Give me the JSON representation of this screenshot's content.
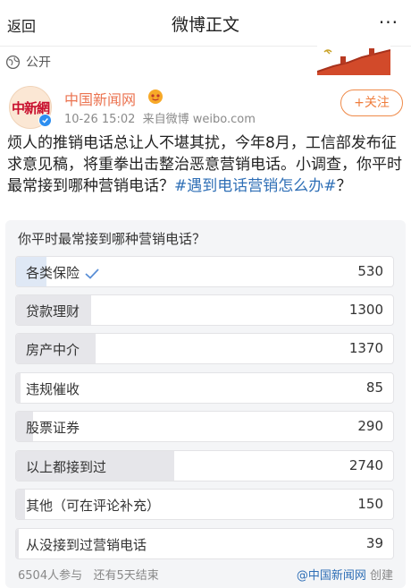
{
  "header": {
    "back_label": "返回",
    "title": "微博正文",
    "more_label": "···"
  },
  "visibility": {
    "label": "公开"
  },
  "author": {
    "avatar_text": "中新網",
    "name": "中国新闻网",
    "time": "10-26 15:02",
    "source_prefix": "来自微博",
    "source": "weibo.com",
    "follow_label": "+关注"
  },
  "post": {
    "text": "烦人的推销电话总让人不堪其扰，今年8月，工信部发布征求意见稿，将重拳出击整治恶意营销电话。小调查，你平时最常接到哪种营销电话？",
    "hashtag": "#遇到电话营销怎么办#",
    "text_end": "？"
  },
  "poll": {
    "question": "你平时最常接到哪种营销电话？",
    "options": [
      {
        "label": "各类保险",
        "count": "530",
        "share": 0.0815,
        "selected": true
      },
      {
        "label": "贷款理财",
        "count": "1300",
        "share": 0.2,
        "selected": false
      },
      {
        "label": "房产中介",
        "count": "1370",
        "share": 0.21,
        "selected": false
      },
      {
        "label": "违规催收",
        "count": "85",
        "share": 0.013,
        "selected": false
      },
      {
        "label": "股票证券",
        "count": "290",
        "share": 0.045,
        "selected": false
      },
      {
        "label": "以上都接到过",
        "count": "2740",
        "share": 0.42,
        "selected": false
      },
      {
        "label": "其他（可在评论补充）",
        "count": "150",
        "share": 0.023,
        "selected": false
      },
      {
        "label": "从没接到过营销电话",
        "count": "39",
        "share": 0.006,
        "selected": false
      }
    ],
    "participants": "6504人参与",
    "remaining": "还有5天结束",
    "creator": "@中国新闻网",
    "created_label": "创建"
  },
  "colors": {
    "accent_orange": "#eb7350",
    "link_blue": "#2f6fb6",
    "verified_blue": "#2c8ef0"
  }
}
